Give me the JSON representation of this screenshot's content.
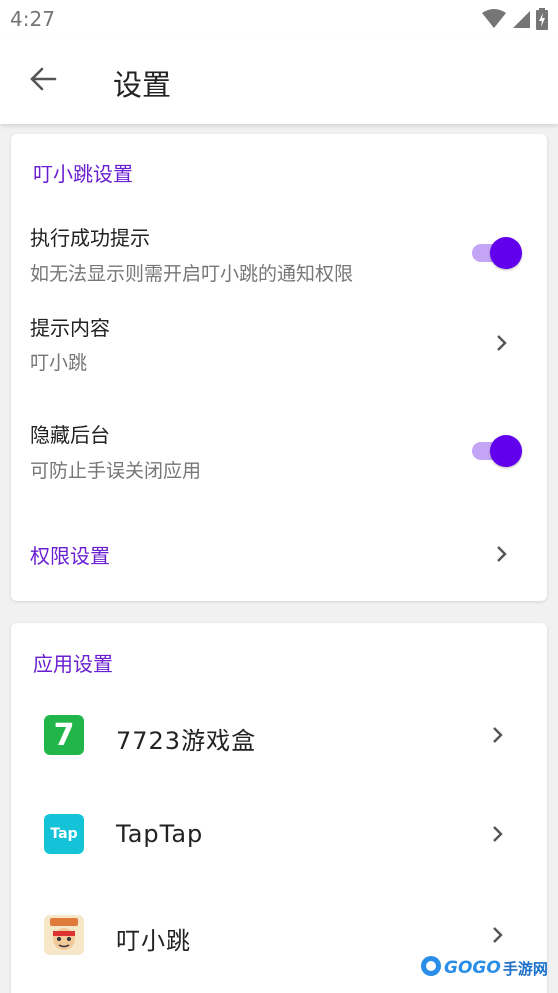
{
  "status_bar": {
    "time": "4:27"
  },
  "app_bar": {
    "title": "设置"
  },
  "section1": {
    "title": "叮小跳设置",
    "items": [
      {
        "title": "执行成功提示",
        "subtitle": "如无法显示则需开启叮小跳的通知权限",
        "control": "toggle",
        "on": true
      },
      {
        "title": "提示内容",
        "subtitle": "叮小跳",
        "control": "chevron"
      },
      {
        "title": "隐藏后台",
        "subtitle": "可防止手误关闭应用",
        "control": "toggle",
        "on": true
      },
      {
        "title": "权限设置",
        "control": "chevron"
      }
    ]
  },
  "section2": {
    "title": "应用设置",
    "apps": [
      {
        "name": "7723游戏盒",
        "icon": "7723-app-icon",
        "icon_text": "7"
      },
      {
        "name": "TapTap",
        "icon": "taptap-app-icon",
        "icon_text": "Tap"
      },
      {
        "name": "叮小跳",
        "icon": "dingxiaotiao-app-icon",
        "icon_text": ""
      }
    ]
  },
  "watermark": {
    "brand": "GOGO",
    "suffix": "手游网"
  },
  "colors": {
    "accent": "#6200ee",
    "section_title": "#6a1fd0",
    "toggle_track": "#c4a4f5"
  }
}
